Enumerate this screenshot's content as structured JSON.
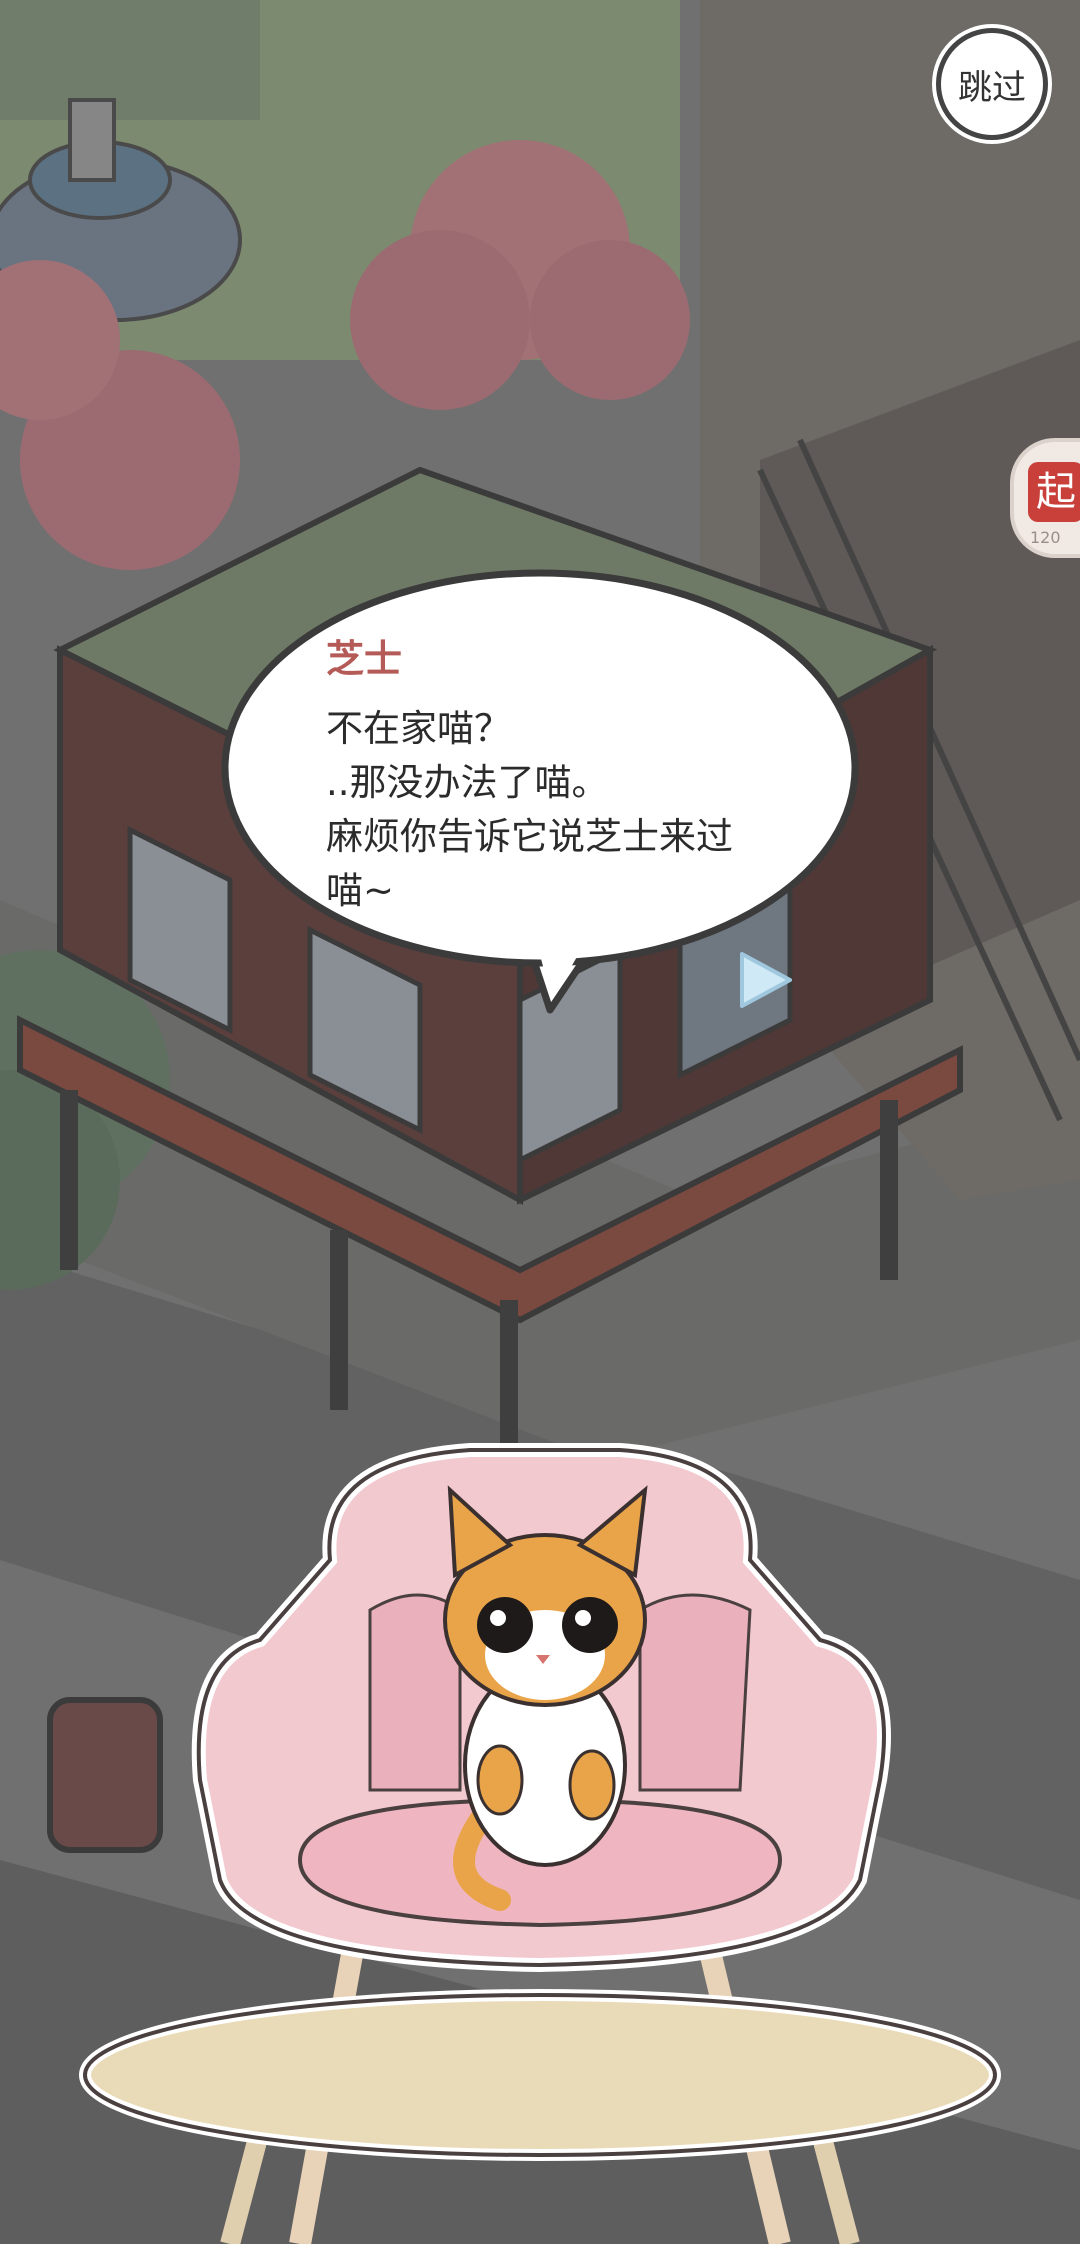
{
  "skip_button": {
    "label": "跳过"
  },
  "side_badge": {
    "glyph": "起",
    "number": "120"
  },
  "dialog": {
    "speaker": "芝士",
    "lines": [
      "不在家喵？",
      "..那没办法了喵。",
      "麻烦你告诉它说芝士来过",
      "喵~"
    ]
  },
  "icons": {
    "next": "next-arrow-icon",
    "skip": "skip-icon"
  },
  "colors": {
    "speaker_name": "#b45a57",
    "bubble": "#ffffff",
    "chair": "#f3c9d0",
    "cat_orange": "#e9a44a",
    "table_top": "#eadbb8"
  }
}
